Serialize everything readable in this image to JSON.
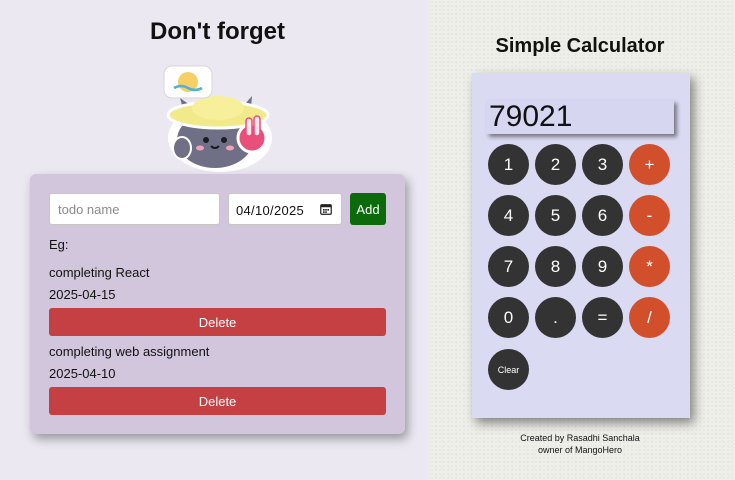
{
  "todo": {
    "title": "Don't forget",
    "input_placeholder": "todo name",
    "date_value": "04/10/2025",
    "add_label": "Add",
    "example_label": "Eg:",
    "items": [
      {
        "name": "completing React",
        "date": "2025-04-15",
        "delete_label": "Delete"
      },
      {
        "name": "completing web assignment",
        "date": "2025-04-10",
        "delete_label": "Delete"
      }
    ]
  },
  "calculator": {
    "title": "Simple Calculator",
    "display_value": "79021",
    "keys": [
      "1",
      "2",
      "3",
      "+",
      "4",
      "5",
      "6",
      "-",
      "7",
      "8",
      "9",
      "*",
      "0",
      ".",
      "=",
      "/",
      "Clear"
    ],
    "credit_line1": "Created by Rasadhi Sanchala",
    "credit_line2": "owner of MangoHero"
  },
  "colors": {
    "left_background": "#ebe8f2",
    "todo_card": "#d2c6dc",
    "add_button": "#0b6b0b",
    "delete_button": "#c44043",
    "calculator_body": "#dbdaf3",
    "number_key": "#333333",
    "operator_key": "#d24f2c"
  },
  "icons": [
    "cat-mascot-sticker",
    "calendar-icon"
  ]
}
